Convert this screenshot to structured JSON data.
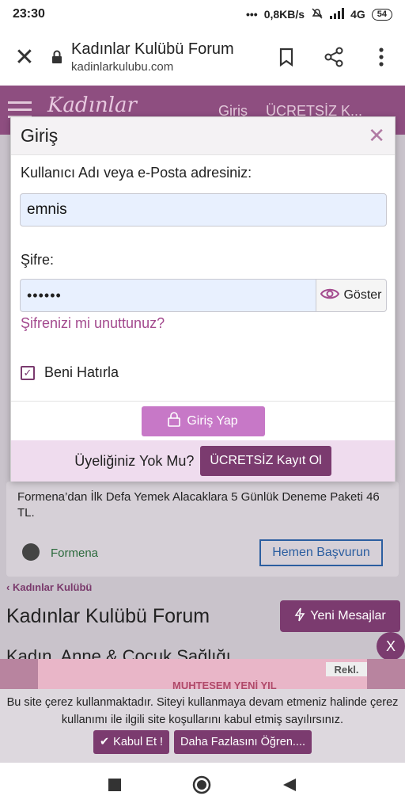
{
  "status": {
    "time": "23:30",
    "dots": "•••",
    "speed": "0,8KB/s",
    "network": "4G",
    "battery": "54"
  },
  "browser": {
    "title": "Kadınlar Kulübü Forum",
    "url": "kadinlarkulubu.com"
  },
  "site": {
    "logo": "Kadınlar",
    "login": "Giriş",
    "register": "ÜCRETSİZ K..."
  },
  "ad": {
    "text": "Formena’dan İlk Defa Yemek Alacaklara 5 Günlük Deneme Paketi 46 TL.",
    "brand": "Formena",
    "cta": "Hemen Başvurun"
  },
  "forum": {
    "breadcrumb": "Kadınlar Kulübü",
    "title": "Kadınlar Kulübü Forum",
    "new_messages": "Yeni Mesajlar",
    "section": "Kadın, Anne & Çocuk Sağlığı",
    "close_fab": "X"
  },
  "adband": {
    "reklam": "Rekl.",
    "promo": "MUHTEŞEM YENİ YIL"
  },
  "cookie": {
    "message": "Bu site çerez kullanmaktadır. Siteyi kullanmaya devam etmeniz halinde çerez kullanımı ile ilgili site koşullarını kabul etmiş sayılırsınız.",
    "accept": "Kabul Et !",
    "more": "Daha Fazlasını Öğren...."
  },
  "modal": {
    "title": "Giriş",
    "username_label": "Kullanıcı Adı veya e-Posta adresiniz:",
    "username_value": "emnis",
    "password_label": "Şifre:",
    "password_value": "••••••",
    "show_label": "Göster",
    "forgot": "Şifrenizi mi unuttunuz?",
    "remember": "Beni Hatırla",
    "login_button": "Giriş Yap",
    "no_account": "Üyeliğiniz Yok Mu?",
    "register_button": "ÜCRETSİZ Kayıt Ol"
  },
  "colors": {
    "brand": "#7b3b6f",
    "login_button": "#c778c7",
    "link": "#a34a8e"
  }
}
